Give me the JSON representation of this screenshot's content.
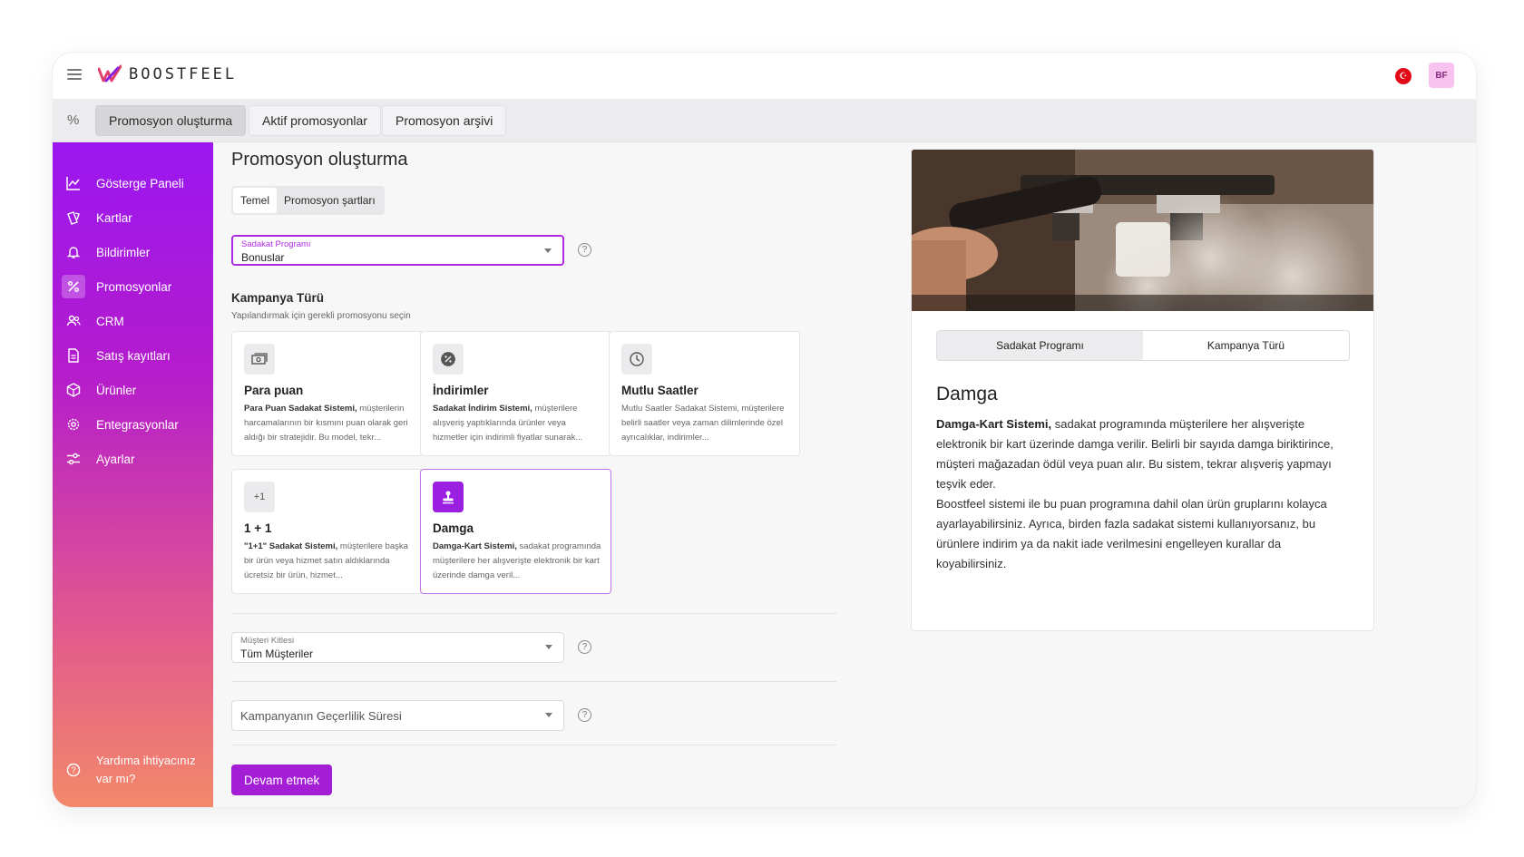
{
  "app": {
    "logo_text": "BOOSTFEEL",
    "avatar_initials": "BF",
    "brand_color": "#9b1fe0",
    "flag_symbol": "☪"
  },
  "top_tabs": [
    {
      "label": "Promosyon oluşturma",
      "active": true
    },
    {
      "label": "Aktif promosyonlar",
      "active": false
    },
    {
      "label": "Promosyon arşivi",
      "active": false
    }
  ],
  "tabstrip_icon": "%",
  "sidebar": {
    "items": [
      {
        "label": "Gösterge Paneli",
        "icon": "chart-line-icon"
      },
      {
        "label": "Kartlar",
        "icon": "cards-icon"
      },
      {
        "label": "Bildirimler",
        "icon": "bell-icon"
      },
      {
        "label": "Promosyonlar",
        "icon": "percent-icon",
        "active": true
      },
      {
        "label": "CRM",
        "icon": "users-icon"
      },
      {
        "label": "Satış kayıtları",
        "icon": "document-icon"
      },
      {
        "label": "Ürünler",
        "icon": "box-icon"
      },
      {
        "label": "Entegrasyonlar",
        "icon": "gear-icon"
      },
      {
        "label": "Ayarlar",
        "icon": "sliders-icon"
      }
    ],
    "help_label": "Yardıma ihtiyacınız var mı?"
  },
  "main": {
    "title": "Promosyon oluşturma",
    "subtabs": [
      {
        "label": "Temel",
        "active": true
      },
      {
        "label": "Promosyon şartları",
        "active": false
      }
    ],
    "loyalty_select": {
      "label": "Sadakat Programı",
      "value": "Bonuslar"
    },
    "campaign_type": {
      "title": "Kampanya Türü",
      "subtitle": "Yapılandırmak için gerekli promosyonu seçin",
      "cards": [
        {
          "title": "Para puan",
          "icon": "money-icon",
          "desc_bold": "Para Puan Sadakat Sistemi,",
          "desc": " müşterilerin harcamalarının bir kısmını puan olarak geri aldığı bir stratejidir. Bu model, tekr..."
        },
        {
          "title": "İndirimler",
          "icon": "discount-badge-icon",
          "desc_bold": "Sadakat İndirim Sistemi,",
          "desc": " müşterilere alışveriş yaptıklarında ürünler veya hizmetler için indirimli fiyatlar sunarak..."
        },
        {
          "title": "Mutlu Saatler",
          "icon": "clock-icon",
          "desc_bold": "",
          "desc": "Mutlu Saatler Sadakat Sistemi, müşterilere belirli saatler veya zaman dilimlerinde özel ayrıcalıklar, indirimler..."
        },
        {
          "title": "1 + 1",
          "icon": "plus-one-icon",
          "icon_text": "+1",
          "desc_bold": "\"1+1\" Sadakat Sistemi,",
          "desc": " müşterilere başka bir ürün veya hizmet satın aldıklarında ücretsiz bir ürün, hizmet..."
        },
        {
          "title": "Damga",
          "icon": "stamp-icon",
          "selected": true,
          "desc_bold": "Damga-Kart Sistemi,",
          "desc": " sadakat programında müşterilere her alışverişte elektronik bir kart üzerinde damga veril..."
        }
      ]
    },
    "audience_select": {
      "label": "Müşteri Kitlesi",
      "value": "Tüm Müşteriler"
    },
    "validity_select": {
      "placeholder": "Kampanyanın Geçerlilik Süresi"
    },
    "continue_label": "Devam etmek"
  },
  "panel": {
    "tabs": [
      {
        "label": "Sadakat Programı",
        "active": true
      },
      {
        "label": "Kampanya Türü",
        "active": false
      }
    ],
    "title": "Damga",
    "body_bold": "Damga-Kart Sistemi,",
    "body_1": " sadakat programında müşterilere her alışverişte elektronik bir kart üzerinde damga verilir. Belirli bir sayıda damga biriktirince, müşteri mağazadan ödül veya puan alır. Bu sistem, tekrar alışveriş yapmayı teşvik eder.",
    "body_2": "Boostfeel sistemi ile bu puan programına dahil olan ürün gruplarını kolayca ayarlayabilirsiniz. Ayrıca, birden fazla sadakat sistemi kullanıyorsanız, bu ürünlere indirim ya da nakit iade verilmesini engelleyen kurallar da koyabilirsiniz."
  }
}
